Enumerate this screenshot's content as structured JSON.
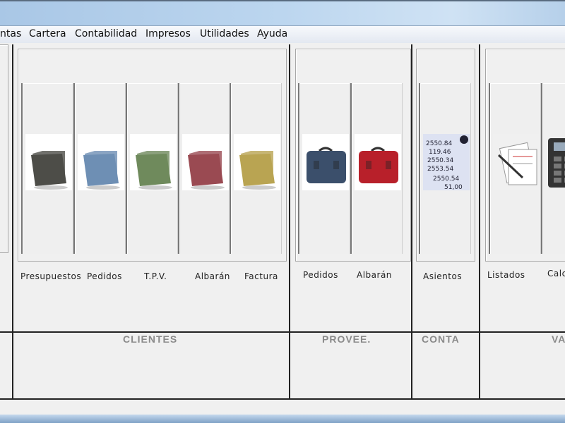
{
  "menu": [
    "ntas",
    "Cartera",
    "Contabilidad",
    "Impresos",
    "Utilidades",
    "Ayuda"
  ],
  "clientes": {
    "title": "CLIENTES",
    "buttons": [
      {
        "label": "Presupuestos",
        "icon": "folder-gray-icon",
        "color": "#4d4d48"
      },
      {
        "label": "Pedidos",
        "icon": "folder-blue-icon",
        "color": "#6e8fb4"
      },
      {
        "label": "T.P.V.",
        "icon": "folder-green-icon",
        "color": "#6f8a5c"
      },
      {
        "label": "Albarán",
        "icon": "folder-red-icon",
        "color": "#9a4a52"
      },
      {
        "label": "Factura",
        "icon": "folder-yellow-icon",
        "color": "#b9a452"
      }
    ]
  },
  "proveedores": {
    "title": "PROVEE.",
    "buttons": [
      {
        "label": "Pedidos",
        "icon": "briefcase-blue-icon",
        "color": "#3b4f6b"
      },
      {
        "label": "Albarán",
        "icon": "briefcase-red-icon",
        "color": "#b8202a"
      }
    ]
  },
  "conta": {
    "title": "CONTA",
    "buttons": [
      {
        "label": "Asientos",
        "icon": "ledger-paper-icon"
      }
    ]
  },
  "varios": {
    "title": "VA",
    "buttons": [
      {
        "label": "Listados",
        "icon": "documents-pen-icon"
      },
      {
        "label": "Calc",
        "icon": "calculator-icon"
      }
    ]
  }
}
